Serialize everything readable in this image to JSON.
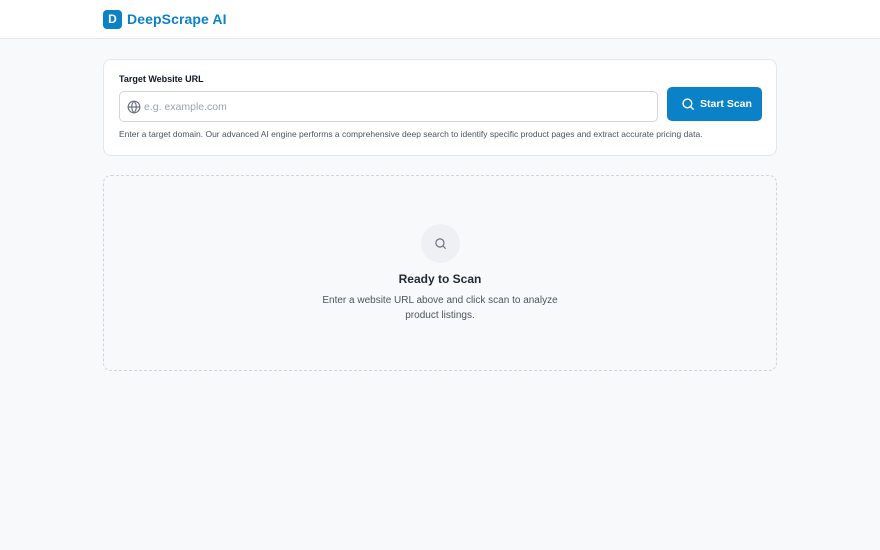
{
  "header": {
    "logo_letter": "D",
    "brand_name": "DeepScrape AI"
  },
  "scan_form": {
    "label": "Target Website URL",
    "placeholder": "e.g. example.com",
    "value": "",
    "button_label": "Start Scan",
    "helper_text": "Enter a target domain. Our advanced AI engine performs a comprehensive deep search to identify specific product pages and extract accurate pricing data."
  },
  "empty_state": {
    "title": "Ready to Scan",
    "description": "Enter a website URL above and click scan to analyze product listings."
  },
  "colors": {
    "accent": "#0b82c8",
    "background": "#f8f9fb",
    "border": "#e5e7eb"
  },
  "icons": {
    "input_icon": "globe-icon",
    "button_icon": "search-icon",
    "empty_state_icon": "search-icon"
  }
}
